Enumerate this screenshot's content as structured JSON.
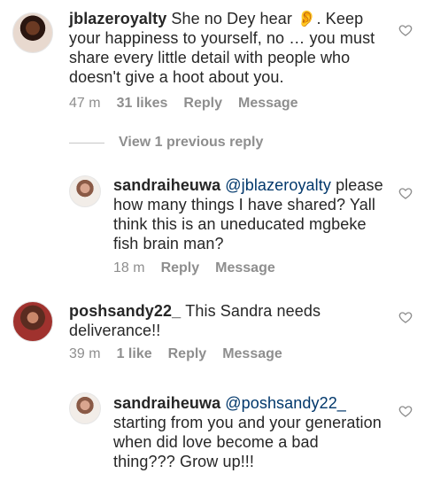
{
  "comments": [
    {
      "username": "jblazeroyalty",
      "text": "She no Dey hear 👂. Keep your happiness to yourself, no … you must share every little detail with people who doesn't give a hoot about you.",
      "time": "47 m",
      "likes": "31 likes",
      "reply_label": "Reply",
      "message_label": "Message"
    },
    {
      "username": "sandraiheuwa",
      "mention": "@jblazeroyalty",
      "text": "please how many things I have shared? Yall think this is an uneducated mgbeke fish brain man?",
      "time": "18 m",
      "reply_label": "Reply",
      "message_label": "Message"
    },
    {
      "username": "poshsandy22_",
      "text": "This Sandra needs deliverance!!",
      "time": "39 m",
      "likes": "1 like",
      "reply_label": "Reply",
      "message_label": "Message"
    },
    {
      "username": "sandraiheuwa",
      "mention": "@poshsandy22_",
      "text": "starting from you and your generation when did love become a bad thing??? Grow up!!!",
      "time": "",
      "reply_label": "",
      "message_label": ""
    }
  ],
  "view_previous": "View 1 previous reply",
  "icons": {
    "like": "heart-outline-icon",
    "avatar": "avatar"
  },
  "colors": {
    "text": "#262626",
    "meta": "#8e8e8e",
    "mention": "#00376b"
  }
}
